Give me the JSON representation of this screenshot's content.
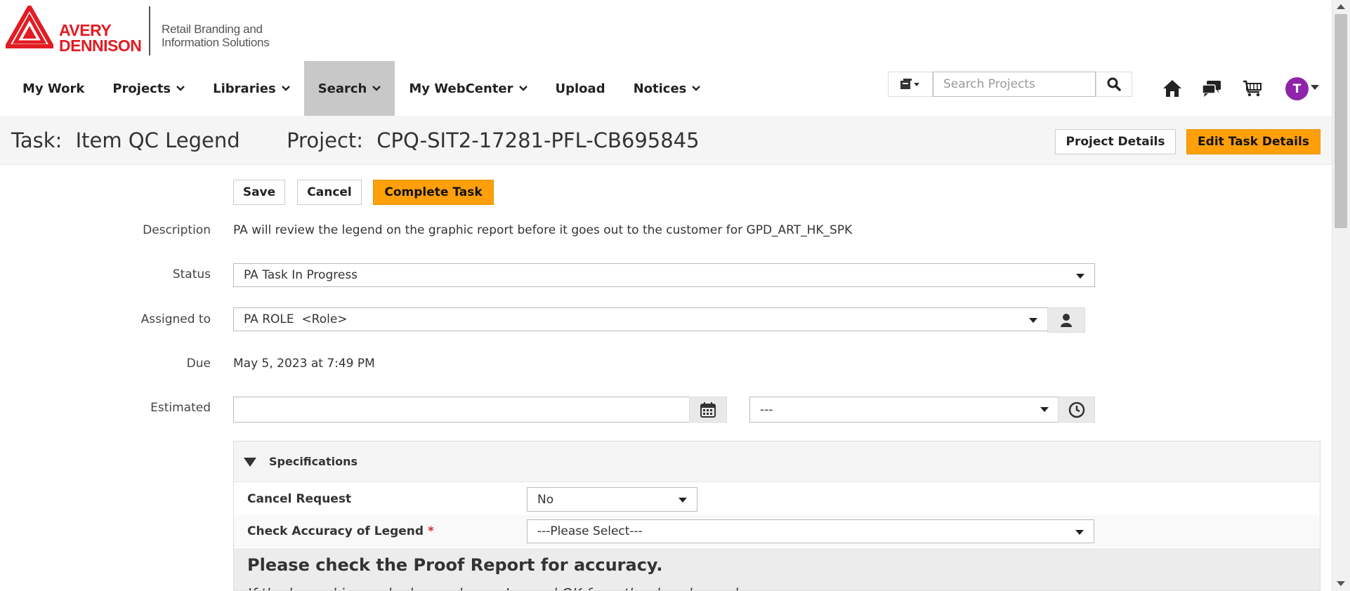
{
  "brand": {
    "name_line1": "AVERY",
    "name_line2": "DENNISON",
    "tagline_line1": "Retail Branding and",
    "tagline_line2": "Information Solutions",
    "color": "#e31b23"
  },
  "nav": {
    "items": [
      {
        "label": "My Work",
        "dropdown": false
      },
      {
        "label": "Projects",
        "dropdown": true
      },
      {
        "label": "Libraries",
        "dropdown": true
      },
      {
        "label": "Search",
        "dropdown": true,
        "active": true
      },
      {
        "label": "My WebCenter",
        "dropdown": true
      },
      {
        "label": "Upload",
        "dropdown": false
      },
      {
        "label": "Notices",
        "dropdown": true
      }
    ]
  },
  "header": {
    "search_placeholder": "Search Projects",
    "avatar_initial": "T",
    "avatar_color": "#8e24aa",
    "icons": [
      "view-switch-icon",
      "search-icon",
      "home-icon",
      "chat-icon",
      "cart-icon"
    ]
  },
  "title": {
    "task_label": "Task:",
    "task_name": "Item QC Legend",
    "project_label": "Project:",
    "project_name": "CPQ-SIT2-17281-PFL-CB695845",
    "project_details_button": "Project Details",
    "edit_task_button": "Edit Task Details"
  },
  "actions": {
    "save": "Save",
    "cancel": "Cancel",
    "complete": "Complete Task",
    "accent_color": "#ff9f0a"
  },
  "form": {
    "description_label": "Description",
    "description_value": "PA will review the legend on the graphic report before it goes out to the customer for GPD_ART_HK_SPK",
    "status_label": "Status",
    "status_value": "PA Task In Progress",
    "assigned_label": "Assigned to",
    "assigned_value": "PA ROLE  <Role>",
    "due_label": "Due",
    "due_value": "May 5, 2023 at 7:49 PM",
    "estimated_label": "Estimated",
    "estimated_date_value": "",
    "estimated_time_value": "---"
  },
  "specifications": {
    "title": "Specifications",
    "rows": [
      {
        "label": "Cancel Request",
        "value": "No",
        "required": false
      },
      {
        "label": "Check Accuracy of Legend",
        "value": "---Please Select---",
        "required": true
      }
    ],
    "required_mark": "*",
    "note_heading": "Please check the Proof Report for accuracy.",
    "note_text": "If the legend is good, please choose Legend OK from the dropdown above."
  }
}
